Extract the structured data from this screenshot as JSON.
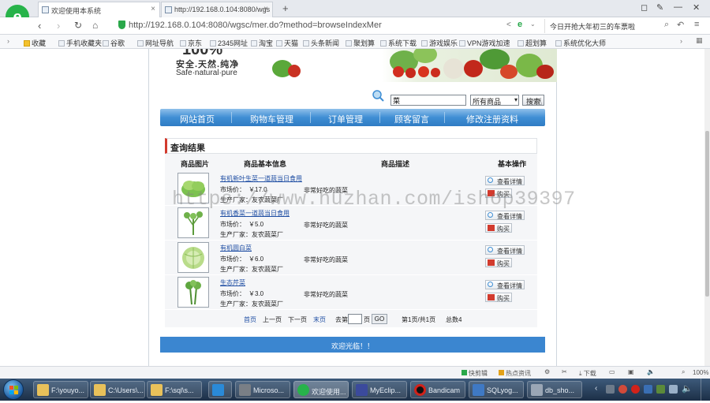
{
  "browser": {
    "tabs": [
      {
        "label": "欢迎使用本系统"
      },
      {
        "label": "http://192.168.0.104:8080/wgs"
      }
    ],
    "new_tab": "+",
    "url": "http://192.168.0.104:8080/wgsc/mer.do?method=browseIndexMer",
    "url_host": "192.168.0.104",
    "news_ticker": "今日开抢大年初三的车票啦",
    "bookmarks": [
      "收藏",
      "手机收藏夹",
      "谷歌",
      "网址导航",
      "京东",
      "2345网址",
      "淘宝",
      "天猫",
      "头条新闻",
      "聚划算",
      "系统下载",
      "游戏娱乐",
      "VPN游戏加速",
      "超划算",
      "系统优化大师"
    ],
    "status_items": [
      "快剪辑",
      "热点资讯",
      "下载",
      "100%"
    ]
  },
  "banner": {
    "percent": "100%",
    "slogan_cn": "安全.天然.纯净",
    "slogan_en": "Safe·natural·pure"
  },
  "search": {
    "keyword": "菜",
    "category_selected": "所有商品",
    "submit_label": "搜索"
  },
  "nav": {
    "items": [
      "网站首页",
      "购物车管理",
      "订单管理",
      "顾客留言",
      "修改注册资料"
    ]
  },
  "results": {
    "title": "查询结果",
    "columns": [
      "商品图片",
      "商品基本信息",
      "商品描述",
      "基本操作"
    ],
    "price_label": "市场价：",
    "maker_label": "生产厂家：",
    "detail_btn": "查看详情",
    "buy_btn": "购买",
    "items": [
      {
        "name": "有机新叶生菜一道蔬当日食用",
        "price": "￥17.0",
        "maker": "友农蔬菜厂",
        "desc": "非常好吃的蔬菜"
      },
      {
        "name": "有机香菜一道蔬当日食用",
        "price": "￥5.0",
        "maker": "友农蔬菜厂",
        "desc": "非常好吃的蔬菜"
      },
      {
        "name": "有机圆白菜",
        "price": "￥6.0",
        "maker": "友农蔬菜厂",
        "desc": "非常好吃的蔬菜"
      },
      {
        "name": "生态芹菜",
        "price": "￥3.0",
        "maker": "友农蔬菜厂",
        "desc": "非常好吃的蔬菜"
      }
    ]
  },
  "pagination": {
    "first": "首页",
    "prev": "上一页",
    "next": "下一页",
    "last": "末页",
    "goto_prefix": "去第",
    "goto_suffix": "页",
    "go_btn": "GO",
    "page_info": "第1页/共1页",
    "total": "总数4"
  },
  "footer": {
    "text": "欢迎光临！！"
  },
  "watermark": "https://www.huzhan.com/ishop39397",
  "taskbar": {
    "items": [
      "F:\\youyo...",
      "C:\\Users\\...",
      "F:\\sql\\s...",
      "",
      "Microso...",
      "欢迎使用...",
      "MyEclip...",
      "Bandicam",
      "SQLyog...",
      "db_sho..."
    ]
  },
  "colors": {
    "nav_blue": "#3f8ed4",
    "link_blue": "#1f4ea3",
    "accent_red": "#d23b2e",
    "footer_blue": "#3b86d0"
  }
}
